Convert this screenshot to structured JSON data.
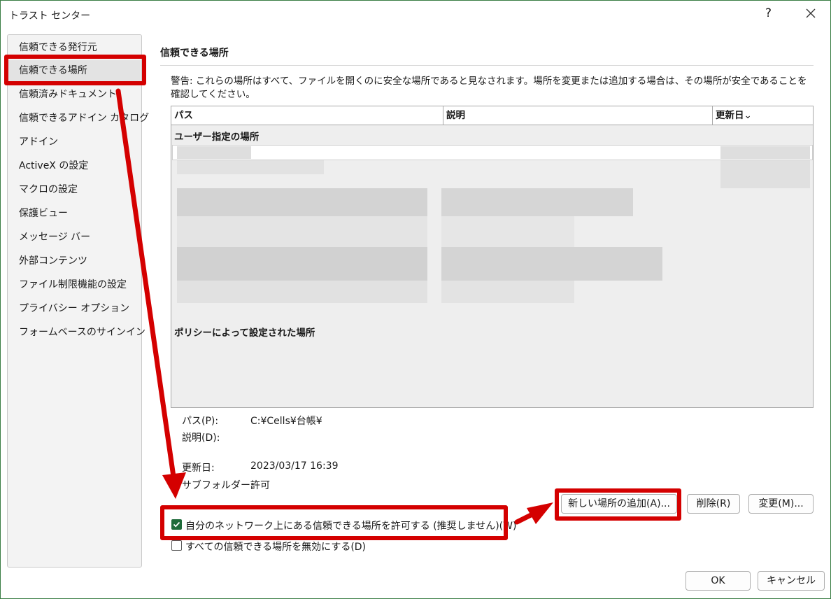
{
  "window": {
    "title": "トラスト センター",
    "help_label": "?",
    "close_icon": "close-icon"
  },
  "sidebar": {
    "items": [
      {
        "label": "信頼できる発行元"
      },
      {
        "label": "信頼できる場所",
        "selected": true
      },
      {
        "label": "信頼済みドキュメント"
      },
      {
        "label": "信頼できるアドイン カタログ"
      },
      {
        "label": "アドイン"
      },
      {
        "label": "ActiveX の設定"
      },
      {
        "label": "マクロの設定"
      },
      {
        "label": "保護ビュー"
      },
      {
        "label": "メッセージ バー"
      },
      {
        "label": "外部コンテンツ"
      },
      {
        "label": "ファイル制限機能の設定"
      },
      {
        "label": "プライバシー オプション"
      },
      {
        "label": "フォームベースのサインイン"
      }
    ]
  },
  "main": {
    "title": "信頼できる場所",
    "warning": "警告: これらの場所はすべて、ファイルを開くのに安全な場所であると見なされます。場所を変更または追加する場合は、その場所が安全であることを確認してください。",
    "table": {
      "columns": [
        "パス",
        "説明",
        "更新日"
      ],
      "sort_indicator": "⌄",
      "groups": [
        "ユーザー指定の場所",
        "ポリシーによって設定された場所"
      ]
    },
    "details": {
      "path_label": "パス(P):",
      "path_value": "C:¥Cells¥台帳¥",
      "desc_label": "説明(D):",
      "desc_value": "",
      "date_label": "更新日:",
      "date_value": "2023/03/17 16:39",
      "subfolder_label": "サブフォルダー:",
      "subfolder_value": "許可"
    },
    "buttons": {
      "add": "新しい場所の追加(A)...",
      "remove": "削除(R)",
      "modify": "変更(M)..."
    },
    "checkboxes": {
      "allow_network": {
        "label": "自分のネットワーク上にある信頼できる場所を許可する (推奨しません)(W)",
        "checked": true
      },
      "disable_all": {
        "label": "すべての信頼できる場所を無効にする(D)",
        "checked": false
      }
    }
  },
  "footer": {
    "ok": "OK",
    "cancel": "キャンセル"
  },
  "colors": {
    "annotation": "#d40000",
    "checkbox_accent": "#1e6b3a",
    "window_border": "#3a7d44"
  }
}
